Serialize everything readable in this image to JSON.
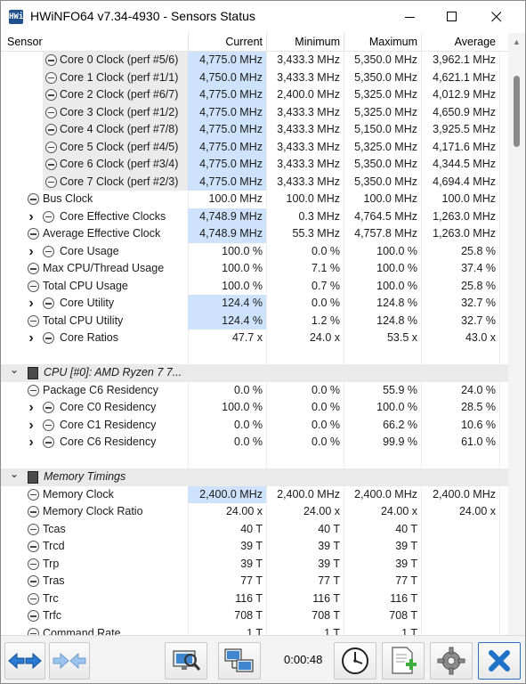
{
  "window": {
    "title": "HWiNFO64 v7.34-4930 - Sensors Status",
    "app_icon_text": "HWi"
  },
  "columns": {
    "sensor": "Sensor",
    "current": "Current",
    "minimum": "Minimum",
    "maximum": "Maximum",
    "average": "Average"
  },
  "rows": [
    {
      "kind": "sub",
      "label": "Core 0 Clock (perf #5/6)",
      "current": "4,775.0 MHz",
      "minimum": "3,433.3 MHz",
      "maximum": "5,350.0 MHz",
      "average": "3,962.1 MHz",
      "hl": true
    },
    {
      "kind": "sub",
      "label": "Core 1 Clock (perf #1/1)",
      "current": "4,750.0 MHz",
      "minimum": "3,433.3 MHz",
      "maximum": "5,350.0 MHz",
      "average": "4,621.1 MHz",
      "hl": true
    },
    {
      "kind": "sub",
      "label": "Core 2 Clock (perf #6/7)",
      "current": "4,775.0 MHz",
      "minimum": "2,400.0 MHz",
      "maximum": "5,325.0 MHz",
      "average": "4,012.9 MHz",
      "hl": true
    },
    {
      "kind": "sub",
      "label": "Core 3 Clock (perf #1/2)",
      "current": "4,775.0 MHz",
      "minimum": "3,433.3 MHz",
      "maximum": "5,325.0 MHz",
      "average": "4,650.9 MHz",
      "hl": true
    },
    {
      "kind": "sub",
      "label": "Core 4 Clock (perf #7/8)",
      "current": "4,775.0 MHz",
      "minimum": "3,433.3 MHz",
      "maximum": "5,150.0 MHz",
      "average": "3,925.5 MHz",
      "hl": true
    },
    {
      "kind": "sub",
      "label": "Core 5 Clock (perf #4/5)",
      "current": "4,775.0 MHz",
      "minimum": "3,433.3 MHz",
      "maximum": "5,325.0 MHz",
      "average": "4,171.6 MHz",
      "hl": true
    },
    {
      "kind": "sub",
      "label": "Core 6 Clock (perf #3/4)",
      "current": "4,775.0 MHz",
      "minimum": "3,433.3 MHz",
      "maximum": "5,350.0 MHz",
      "average": "4,344.5 MHz",
      "hl": true
    },
    {
      "kind": "sub",
      "label": "Core 7 Clock (perf #2/3)",
      "current": "4,775.0 MHz",
      "minimum": "3,433.3 MHz",
      "maximum": "5,350.0 MHz",
      "average": "4,694.4 MHz",
      "hl": true
    },
    {
      "kind": "item",
      "label": "Bus Clock",
      "current": "100.0 MHz",
      "minimum": "100.0 MHz",
      "maximum": "100.0 MHz",
      "average": "100.0 MHz"
    },
    {
      "kind": "expand",
      "label": "Core Effective Clocks",
      "current": "4,748.9 MHz",
      "minimum": "0.3 MHz",
      "maximum": "4,764.5 MHz",
      "average": "1,263.0 MHz",
      "hl": true
    },
    {
      "kind": "item",
      "label": "Average Effective Clock",
      "current": "4,748.9 MHz",
      "minimum": "55.3 MHz",
      "maximum": "4,757.8 MHz",
      "average": "1,263.0 MHz",
      "hl": true
    },
    {
      "kind": "expand",
      "label": "Core Usage",
      "current": "100.0 %",
      "minimum": "0.0 %",
      "maximum": "100.0 %",
      "average": "25.8 %"
    },
    {
      "kind": "item",
      "label": "Max CPU/Thread Usage",
      "current": "100.0 %",
      "minimum": "7.1 %",
      "maximum": "100.0 %",
      "average": "37.4 %"
    },
    {
      "kind": "item",
      "label": "Total CPU Usage",
      "current": "100.0 %",
      "minimum": "0.7 %",
      "maximum": "100.0 %",
      "average": "25.8 %"
    },
    {
      "kind": "expand",
      "label": "Core Utility",
      "current": "124.4 %",
      "minimum": "0.0 %",
      "maximum": "124.8 %",
      "average": "32.7 %",
      "hl": true
    },
    {
      "kind": "item",
      "label": "Total CPU Utility",
      "current": "124.4 %",
      "minimum": "1.2 %",
      "maximum": "124.8 %",
      "average": "32.7 %",
      "hl": true
    },
    {
      "kind": "expand",
      "label": "Core Ratios",
      "current": "47.7 x",
      "minimum": "24.0 x",
      "maximum": "53.5 x",
      "average": "43.0 x"
    },
    {
      "kind": "blank"
    },
    {
      "kind": "group",
      "label": "CPU [#0]: AMD Ryzen 7 7..."
    },
    {
      "kind": "item",
      "label": "Package C6 Residency",
      "current": "0.0 %",
      "minimum": "0.0 %",
      "maximum": "55.9 %",
      "average": "24.0 %"
    },
    {
      "kind": "expand",
      "label": "Core C0 Residency",
      "current": "100.0 %",
      "minimum": "0.0 %",
      "maximum": "100.0 %",
      "average": "28.5 %"
    },
    {
      "kind": "expand",
      "label": "Core C1 Residency",
      "current": "0.0 %",
      "minimum": "0.0 %",
      "maximum": "66.2 %",
      "average": "10.6 %"
    },
    {
      "kind": "expand",
      "label": "Core C6 Residency",
      "current": "0.0 %",
      "minimum": "0.0 %",
      "maximum": "99.9 %",
      "average": "61.0 %"
    },
    {
      "kind": "blank"
    },
    {
      "kind": "group",
      "label": "Memory Timings"
    },
    {
      "kind": "item",
      "label": "Memory Clock",
      "current": "2,400.0 MHz",
      "minimum": "2,400.0 MHz",
      "maximum": "2,400.0 MHz",
      "average": "2,400.0 MHz",
      "hl": true
    },
    {
      "kind": "item",
      "label": "Memory Clock Ratio",
      "current": "24.00 x",
      "minimum": "24.00 x",
      "maximum": "24.00 x",
      "average": "24.00 x"
    },
    {
      "kind": "item",
      "label": "Tcas",
      "current": "40 T",
      "minimum": "40 T",
      "maximum": "40 T",
      "average": ""
    },
    {
      "kind": "item",
      "label": "Trcd",
      "current": "39 T",
      "minimum": "39 T",
      "maximum": "39 T",
      "average": ""
    },
    {
      "kind": "item",
      "label": "Trp",
      "current": "39 T",
      "minimum": "39 T",
      "maximum": "39 T",
      "average": ""
    },
    {
      "kind": "item",
      "label": "Tras",
      "current": "77 T",
      "minimum": "77 T",
      "maximum": "77 T",
      "average": ""
    },
    {
      "kind": "item",
      "label": "Trc",
      "current": "116 T",
      "minimum": "116 T",
      "maximum": "116 T",
      "average": ""
    },
    {
      "kind": "item",
      "label": "Trfc",
      "current": "708 T",
      "minimum": "708 T",
      "maximum": "708 T",
      "average": ""
    },
    {
      "kind": "item",
      "label": "Command Rate",
      "current": "1 T",
      "minimum": "1 T",
      "maximum": "1 T",
      "average": ""
    }
  ],
  "toolbar": {
    "elapsed": "0:00:48"
  },
  "colors": {
    "highlight": "#cfe2fb",
    "group_bg": "#eaeaea",
    "accent_blue": "#1e73c8"
  }
}
